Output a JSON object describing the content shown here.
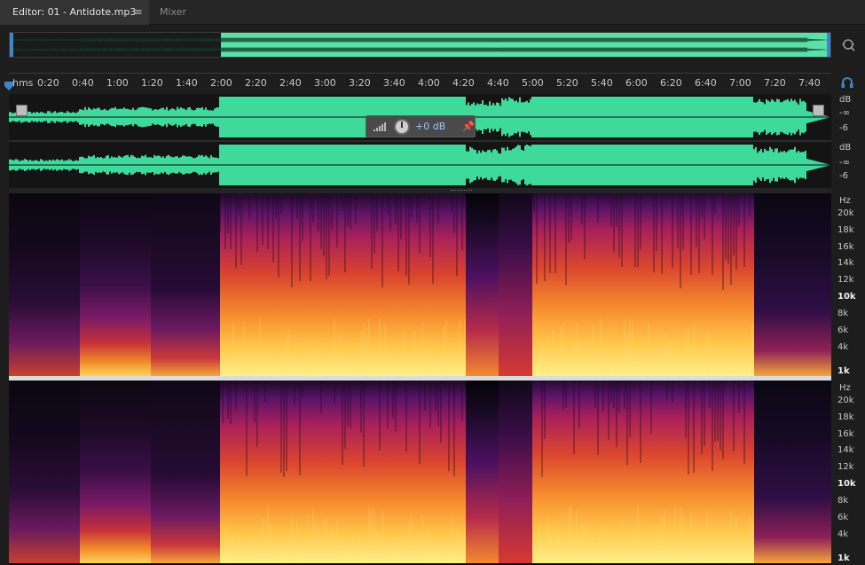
{
  "tabs": {
    "editor": "Editor: 01 - Antidote.mp3",
    "menu": "≡",
    "mixer": "Mixer"
  },
  "ruler": {
    "unit": "hms",
    "ticks": [
      "0:20",
      "0:40",
      "1:00",
      "1:20",
      "1:40",
      "2:00",
      "2:20",
      "2:40",
      "3:00",
      "3:20",
      "3:40",
      "4:00",
      "4:20",
      "4:40",
      "5:00",
      "5:20",
      "5:40",
      "6:00",
      "6:20",
      "6:40",
      "7:00",
      "7:20",
      "7:40"
    ]
  },
  "hud": {
    "value": "+0 dB",
    "pin": "📌"
  },
  "db_scale": {
    "top": [
      "dB",
      "-∞",
      "-6"
    ],
    "bottom": [
      "dB",
      "-∞",
      "-6"
    ]
  },
  "hz_scale": {
    "unit": "Hz",
    "labels": [
      "20k",
      "18k",
      "16k",
      "14k",
      "12k",
      "10k",
      "8k",
      "6k",
      "4k",
      "1k"
    ]
  },
  "colors": {
    "waveform": "#3fd99c",
    "selection": "#5be0a7",
    "accent": "#3f86c8"
  }
}
